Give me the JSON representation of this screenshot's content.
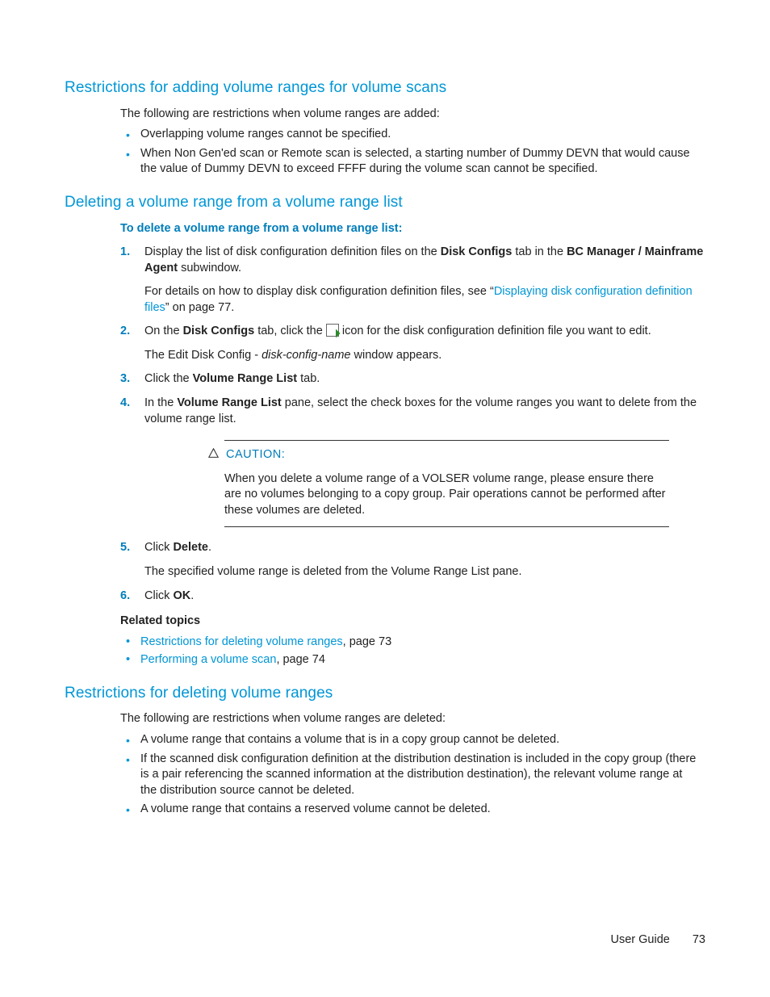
{
  "section1": {
    "heading": "Restrictions for adding volume ranges for volume scans",
    "intro": "The following are restrictions when volume ranges are added:",
    "bullets": [
      "Overlapping volume ranges cannot be specified.",
      "When Non Gen'ed scan or Remote scan is selected, a starting number of Dummy DEVN that would cause the value of Dummy DEVN to exceed FFFF during the volume scan cannot be specified."
    ]
  },
  "section2": {
    "heading": "Deleting a volume range from a volume range list",
    "procTitle": "To delete a volume range from a volume range list:",
    "step1a": "Display the list of disk configuration definition files on the ",
    "step1b": "Disk Configs",
    "step1c": " tab in the ",
    "step1d": "BC Manager / Mainframe Agent",
    "step1e": " subwindow.",
    "step1f": "For details on how to display disk configuration definition files, see “",
    "step1link": "Displaying disk configuration definition files",
    "step1g": "” on page 77.",
    "step2a": "On the ",
    "step2b": "Disk Configs",
    "step2c": " tab, click the ",
    "step2d": " icon for the disk configuration definition file you want to edit.",
    "step2e": "The Edit Disk Config - ",
    "step2f": "disk-config-name",
    "step2g": " window appears.",
    "step3a": "Click the ",
    "step3b": "Volume Range List",
    "step3c": " tab.",
    "step4a": "In the ",
    "step4b": "Volume Range List",
    "step4c": " pane, select the check boxes for the volume ranges you want to delete from the volume range list.",
    "cautionLabel": "CAUTION:",
    "cautionText": "When you delete a volume range of a VOLSER volume range, please ensure there are no volumes belonging to a copy group. Pair operations cannot be performed after these volumes are deleted.",
    "step5a": "Click ",
    "step5b": "Delete",
    "step5c": ".",
    "step5d": "The specified volume range is deleted from the Volume Range List pane.",
    "step6a": "Click ",
    "step6b": "OK",
    "step6c": ".",
    "relatedHeading": "Related topics",
    "related1a": "Restrictions for deleting volume ranges",
    "related1b": ", page 73",
    "related2a": "Performing a volume scan",
    "related2b": ", page 74"
  },
  "section3": {
    "heading": "Restrictions for deleting volume ranges",
    "intro": "The following are restrictions when volume ranges are deleted:",
    "bullets": [
      "A volume range that contains a volume that is in a copy group cannot be deleted.",
      "If the scanned disk configuration definition at the distribution destination is included in the copy group (there is a pair referencing the scanned information at the distribution destination), the relevant volume range at the distribution source cannot be deleted.",
      "A volume range that contains a reserved volume cannot be deleted."
    ]
  },
  "footer": {
    "label": "User Guide",
    "page": "73"
  }
}
